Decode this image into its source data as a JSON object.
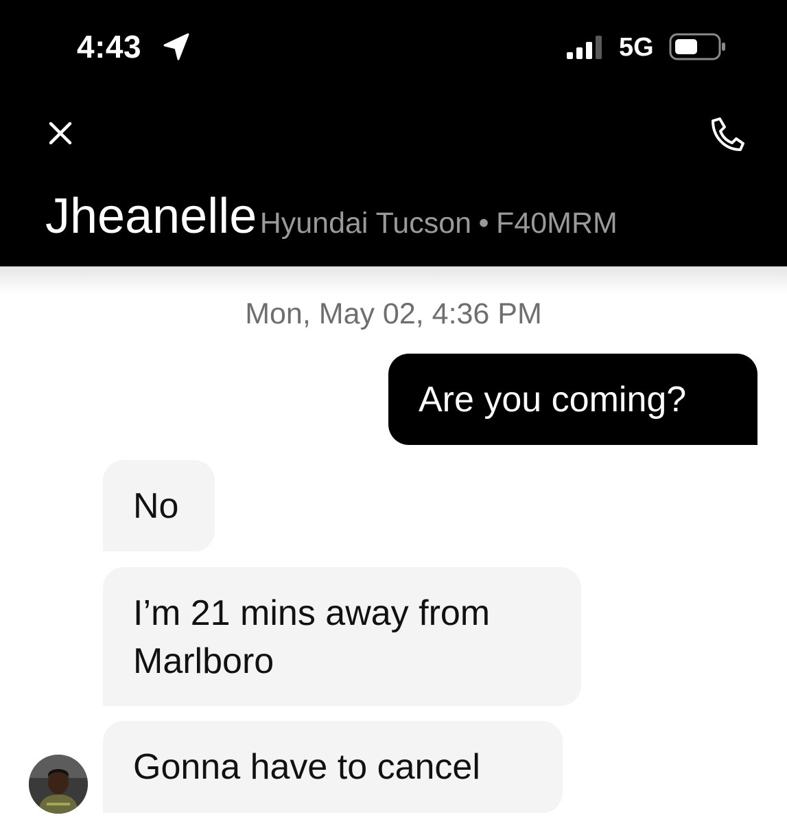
{
  "status_bar": {
    "time": "4:43",
    "location_icon": "location-arrow-icon",
    "signal_icon": "cellular-signal-icon",
    "network": "5G",
    "battery_icon": "battery-icon"
  },
  "header": {
    "close_icon": "close-icon",
    "call_icon": "phone-icon",
    "driver_name": "Jheanelle",
    "vehicle_model": "Hyundai Tucson",
    "separator": "•",
    "plate": "F40MRM",
    "background": "#000000"
  },
  "conversation": {
    "date_stamp": "Mon, May 02, 4:36 PM",
    "messages": [
      {
        "sender": "me",
        "text": "Are you coming?"
      },
      {
        "sender": "driver",
        "text": "No"
      },
      {
        "sender": "driver",
        "text": "I’m 21 mins away from Marlboro"
      },
      {
        "sender": "driver",
        "text": "Gonna have to cancel"
      }
    ],
    "outgoing_bubble_color": "#000000",
    "incoming_bubble_color": "#f4f4f4"
  }
}
